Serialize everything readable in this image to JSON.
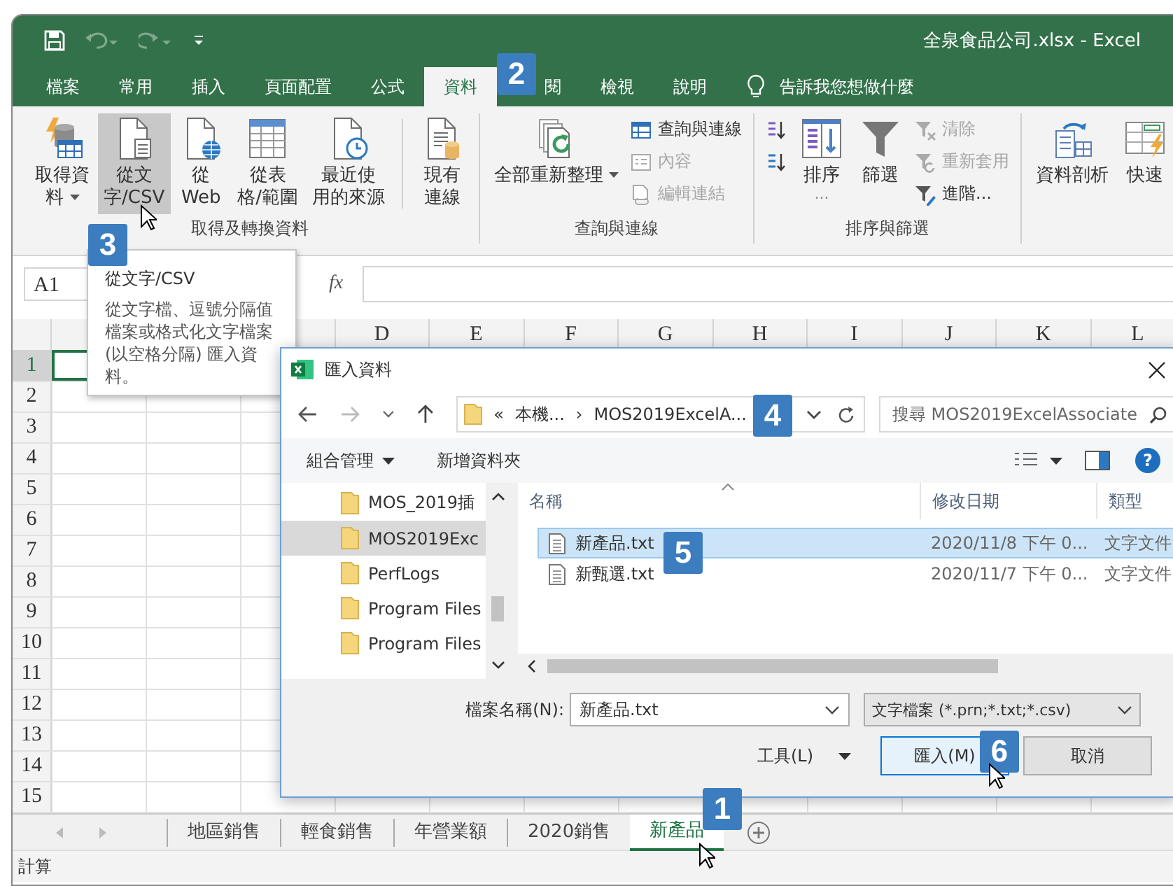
{
  "window": {
    "title": "全泉食品公司.xlsx - Excel"
  },
  "tabs": [
    {
      "label": "檔案",
      "selected": false
    },
    {
      "label": "常用",
      "selected": false
    },
    {
      "label": "插入",
      "selected": false
    },
    {
      "label": "頁面配置",
      "selected": false
    },
    {
      "label": "公式",
      "selected": false
    },
    {
      "label": "資料",
      "selected": true,
      "callout": "2"
    },
    {
      "label": "閱",
      "selected": false
    },
    {
      "label": "檢視",
      "selected": false
    },
    {
      "label": "說明",
      "selected": false
    }
  ],
  "tell_me": "告訴我您想做什麼",
  "ribbon": {
    "groups": [
      {
        "label": "取得及轉換資料",
        "items": [
          {
            "kind": "database",
            "lines": [
              "取得資",
              "料"
            ],
            "dropdown": true,
            "hover": false
          },
          {
            "kind": "textfile",
            "lines": [
              "從文",
              "字/CSV"
            ],
            "hover": true,
            "callout": "3"
          },
          {
            "kind": "web",
            "lines": [
              "從",
              "Web"
            ],
            "hover": false
          },
          {
            "kind": "table",
            "lines": [
              "從表",
              "格/範圍"
            ],
            "hover": false
          },
          {
            "kind": "recent",
            "lines": [
              "最近使",
              "用的來源"
            ],
            "hover": false
          },
          {
            "kind": "connection",
            "lines": [
              "現有",
              "連線"
            ],
            "hover": false
          }
        ]
      },
      {
        "label": "查詢與連線",
        "items": [
          {
            "kind": "refresh",
            "lines": [
              "全部重新整理"
            ],
            "dropdown": true,
            "hover": false
          },
          {
            "kind": "stack",
            "entries": [
              {
                "kind": "queries",
                "label": "查詢與連線",
                "disabled": false
              },
              {
                "kind": "properties",
                "label": "內容",
                "disabled": true
              },
              {
                "kind": "links",
                "label": "編輯連結",
                "disabled": true
              }
            ]
          }
        ]
      },
      {
        "label": "排序與篩選",
        "items": [
          {
            "kind": "stack",
            "entries": [
              {
                "kind": "az"
              },
              {
                "kind": "za"
              }
            ]
          },
          {
            "kind": "sort",
            "lines": [
              "排序"
            ],
            "more": "...",
            "hover": false
          },
          {
            "kind": "filter",
            "lines": [
              "篩選"
            ],
            "hover": false
          },
          {
            "kind": "stack",
            "entries": [
              {
                "kind": "clear",
                "label": "清除",
                "disabled": true
              },
              {
                "kind": "reapply",
                "label": "重新套用",
                "disabled": true
              },
              {
                "kind": "advanced",
                "label": "進階...",
                "disabled": false
              }
            ]
          }
        ]
      },
      {
        "items": [
          {
            "kind": "split",
            "lines": [
              "資料剖析"
            ],
            "hover": false
          },
          {
            "kind": "flashfill",
            "lines": [
              "快速"
            ],
            "hover": false
          }
        ]
      }
    ]
  },
  "formula_bar": {
    "name_box": "A1",
    "fx": "fx"
  },
  "sheet": {
    "columns": [
      "D",
      "E",
      "F",
      "G",
      "H",
      "I",
      "J",
      "K",
      "L"
    ],
    "rows": [
      {
        "label": "1",
        "selected": true
      },
      {
        "label": "2",
        "selected": false
      },
      {
        "label": "3",
        "selected": false
      },
      {
        "label": "4",
        "selected": false
      },
      {
        "label": "5",
        "selected": false
      },
      {
        "label": "6",
        "selected": false
      },
      {
        "label": "7",
        "selected": false
      },
      {
        "label": "8",
        "selected": false
      },
      {
        "label": "9",
        "selected": false
      },
      {
        "label": "10",
        "selected": false
      },
      {
        "label": "11",
        "selected": false
      },
      {
        "label": "12",
        "selected": false
      },
      {
        "label": "13",
        "selected": false
      },
      {
        "label": "14",
        "selected": false
      },
      {
        "label": "15",
        "selected": false
      }
    ]
  },
  "sheet_tabs": [
    {
      "label": "地區銷售",
      "selected": false
    },
    {
      "label": "輕食銷售",
      "selected": false
    },
    {
      "label": "年營業額",
      "selected": false
    },
    {
      "label": "2020銷售",
      "selected": false
    },
    {
      "label": "新產品",
      "selected": true,
      "callout": "1",
      "hover": true
    }
  ],
  "status_bar": "計算",
  "tooltip": {
    "title": "從文字/CSV",
    "text": "從文字檔、逗號分隔值檔案或格式化文字檔案(以空格分隔) 匯入資料。"
  },
  "dialog": {
    "title": "匯入資料",
    "address": {
      "parts": [
        "«",
        "本機...",
        "›",
        "MOS2019ExcelA..."
      ],
      "callout": "4"
    },
    "search": {
      "placeholder": "搜尋 MOS2019ExcelAssociate"
    },
    "toolbar": {
      "organize": "組合管理",
      "new_folder": "新增資料夾",
      "help": "?"
    },
    "nav_items": [
      {
        "label": "MOS_2019插",
        "selected": false
      },
      {
        "label": "MOS2019Exc",
        "selected": true
      },
      {
        "label": "PerfLogs",
        "selected": false
      },
      {
        "label": "Program Files",
        "selected": false
      },
      {
        "label": "Program Files",
        "selected": false
      }
    ],
    "columns": [
      "名稱",
      "修改日期",
      "類型"
    ],
    "files": [
      {
        "name": "新產品.txt",
        "date": "2020/11/8 下午 0...",
        "type": "文字文件",
        "selected": true,
        "callout": "5"
      },
      {
        "name": "新甄選.txt",
        "date": "2020/11/7 下午 0...",
        "type": "文字文件",
        "selected": false
      }
    ],
    "file_name_label": "檔案名稱(N):",
    "file_name": "新產品.txt",
    "file_type": "文字檔案 (*.prn;*.txt;*.csv)",
    "tools": "工具(L)",
    "buttons": [
      {
        "label": "匯入(M)",
        "primary": true,
        "callout": "6",
        "hover": true
      },
      {
        "label": "取消",
        "primary": false
      }
    ]
  }
}
